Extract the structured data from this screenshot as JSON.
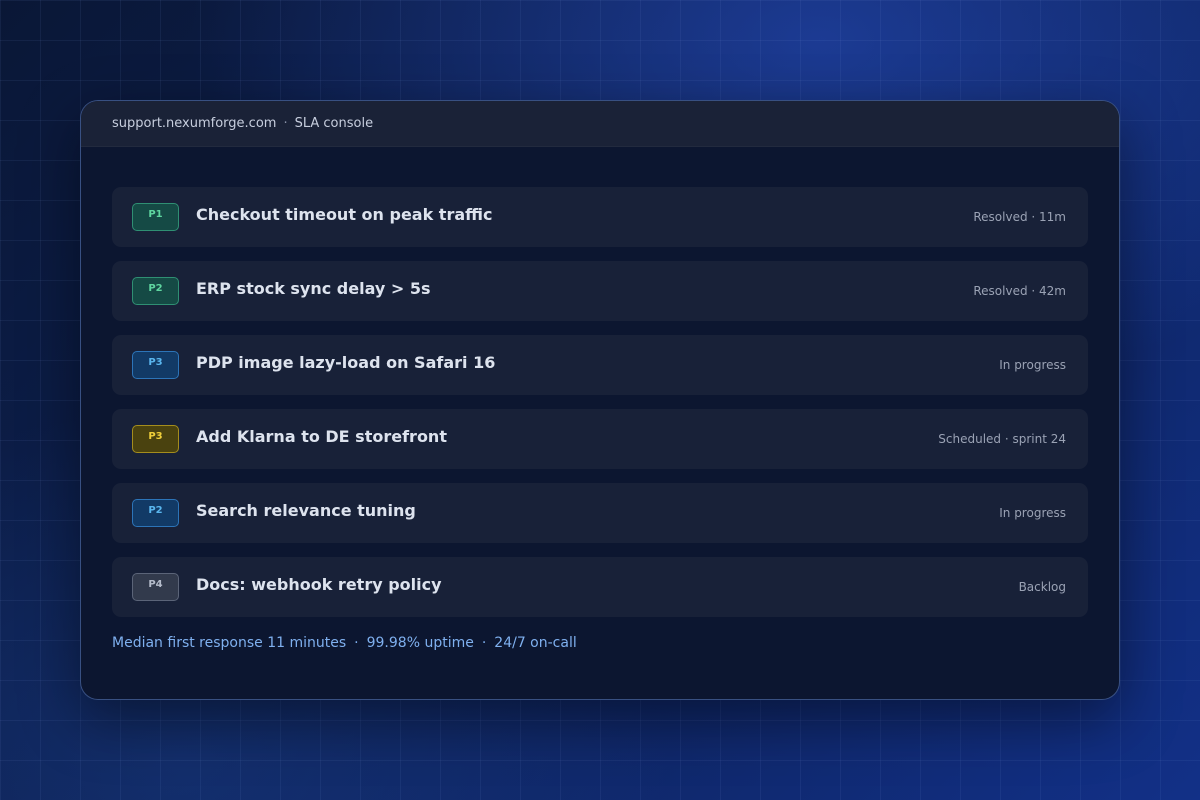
{
  "window": {
    "domain": "support.nexumforge.com",
    "separator": "·",
    "title": "SLA console"
  },
  "tickets": [
    {
      "priority": "P1",
      "priority_color": "green",
      "title": "Checkout timeout on peak traffic",
      "status": "Resolved · 11m"
    },
    {
      "priority": "P2",
      "priority_color": "green",
      "title": "ERP stock sync delay > 5s",
      "status": "Resolved · 42m"
    },
    {
      "priority": "P3",
      "priority_color": "blue",
      "title": "PDP image lazy-load on Safari 16",
      "status": "In progress"
    },
    {
      "priority": "P3",
      "priority_color": "yellow",
      "title": "Add Klarna to DE storefront",
      "status": "Scheduled · sprint 24"
    },
    {
      "priority": "P2",
      "priority_color": "blue",
      "title": "Search relevance tuning",
      "status": "In progress"
    },
    {
      "priority": "P4",
      "priority_color": "gray",
      "title": "Docs: webhook retry policy",
      "status": "Backlog"
    }
  ],
  "footer": {
    "stats": [
      "Median first response 11 minutes",
      "99.98% uptime",
      "24/7 on-call"
    ],
    "separator": "·"
  },
  "colors": {
    "green": "#5fd6a0",
    "blue": "#5ab6ee",
    "yellow": "#f0cf3a",
    "gray": "#b5bccb",
    "footer_text": "#7fb0ef"
  }
}
